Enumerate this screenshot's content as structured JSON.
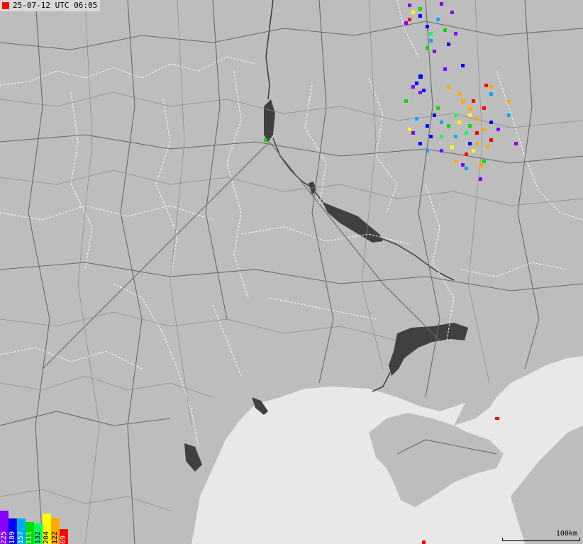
{
  "timestamp": "25-07-12 UTC 06:05",
  "colors": {
    "land": "#bdbdbd",
    "sea": "#e8e8e8",
    "reservoir": "#404040",
    "borders": "#ffffff",
    "roads": "#6a6a6a",
    "stamp_square": "#ff0000"
  },
  "legend": [
    {
      "label": "225",
      "color": "#8800ff"
    },
    {
      "label": "189",
      "color": "#0000ff"
    },
    {
      "label": "157",
      "color": "#00aaff"
    },
    {
      "label": "111",
      "color": "#00dd00"
    },
    {
      "label": "132",
      "color": "#00ff66"
    },
    {
      "label": "204",
      "color": "#ffff00"
    },
    {
      "label": "122",
      "color": "#ffaa00"
    },
    {
      "label": "69",
      "color": "#ff0000"
    }
  ],
  "scale_label": "100km"
}
